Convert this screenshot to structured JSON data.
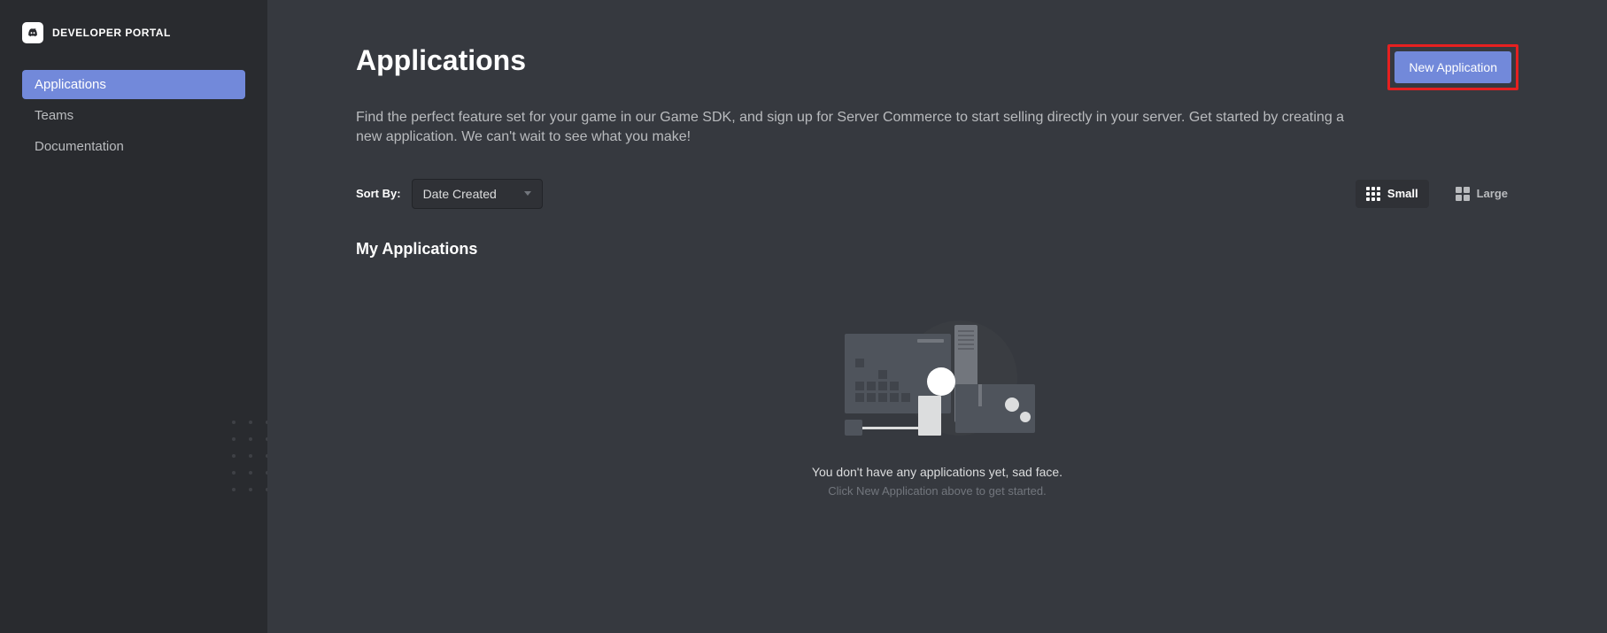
{
  "brand": {
    "text": "DEVELOPER PORTAL"
  },
  "sidebar": {
    "items": [
      {
        "label": "Applications"
      },
      {
        "label": "Teams"
      },
      {
        "label": "Documentation"
      }
    ]
  },
  "header": {
    "title": "Applications",
    "new_app_label": "New Application"
  },
  "description": "Find the perfect feature set for your game in our Game SDK, and sign up for Server Commerce to start selling directly in your server. Get started by creating a new application. We can't wait to see what you make!",
  "sort": {
    "label": "Sort By:",
    "selected": "Date Created"
  },
  "view": {
    "small": "Small",
    "large": "Large"
  },
  "section_title": "My Applications",
  "empty": {
    "title": "You don't have any applications yet, sad face.",
    "sub": "Click New Application above to get started."
  }
}
